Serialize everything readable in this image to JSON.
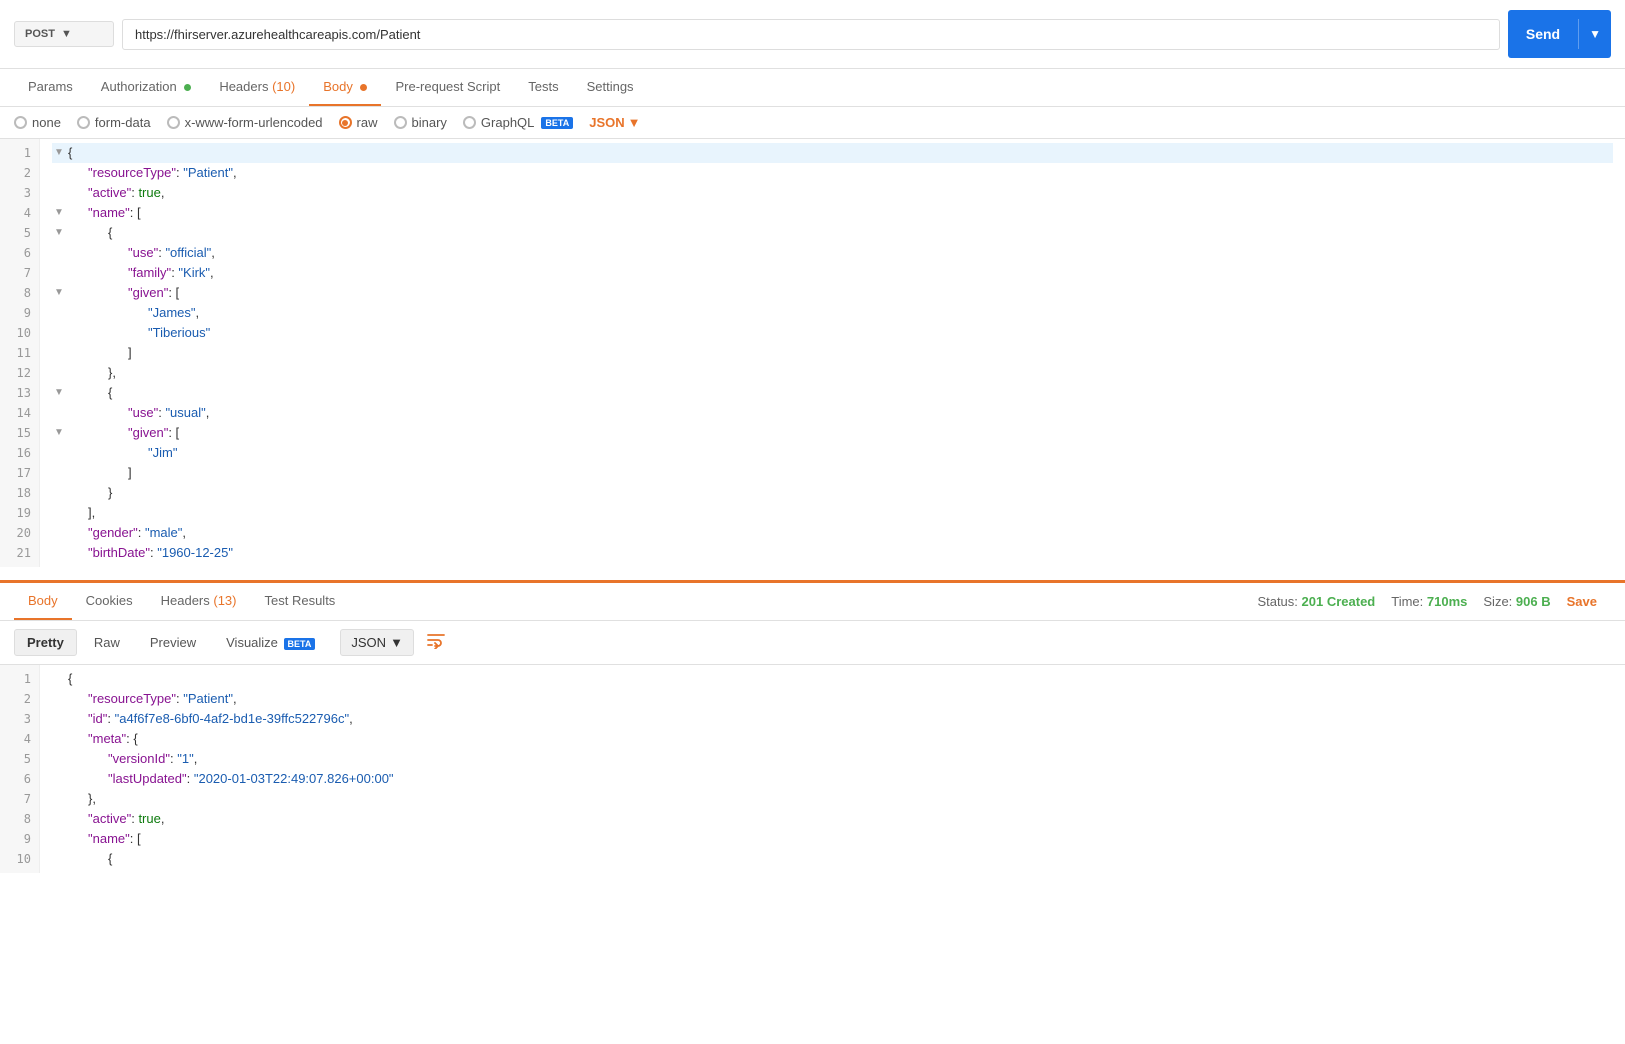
{
  "method": "POST",
  "url": "https://fhirserver.azurehealthcareapis.com/Patient",
  "send_label": "Send",
  "request_tabs": [
    {
      "id": "params",
      "label": "Params",
      "active": false,
      "dot": null
    },
    {
      "id": "authorization",
      "label": "Authorization",
      "active": false,
      "dot": "green"
    },
    {
      "id": "headers",
      "label": "Headers",
      "active": false,
      "dot": null,
      "count": "(10)"
    },
    {
      "id": "body",
      "label": "Body",
      "active": true,
      "dot": "orange"
    },
    {
      "id": "prerequest",
      "label": "Pre-request Script",
      "active": false,
      "dot": null
    },
    {
      "id": "tests",
      "label": "Tests",
      "active": false,
      "dot": null
    },
    {
      "id": "settings",
      "label": "Settings",
      "active": false,
      "dot": null
    }
  ],
  "body_options": [
    {
      "id": "none",
      "label": "none",
      "selected": false
    },
    {
      "id": "form-data",
      "label": "form-data",
      "selected": false
    },
    {
      "id": "x-www-form-urlencoded",
      "label": "x-www-form-urlencoded",
      "selected": false
    },
    {
      "id": "raw",
      "label": "raw",
      "selected": true
    },
    {
      "id": "binary",
      "label": "binary",
      "selected": false
    },
    {
      "id": "graphql",
      "label": "GraphQL",
      "selected": false,
      "beta": true
    }
  ],
  "json_format_label": "JSON",
  "request_code_lines": [
    {
      "num": 1,
      "indent": 0,
      "toggle": true,
      "content": "{"
    },
    {
      "num": 2,
      "indent": 1,
      "toggle": false,
      "content": "\"resourceType\": \"Patient\","
    },
    {
      "num": 3,
      "indent": 1,
      "toggle": false,
      "content": "\"active\": true,"
    },
    {
      "num": 4,
      "indent": 1,
      "toggle": true,
      "content": "\"name\": ["
    },
    {
      "num": 5,
      "indent": 2,
      "toggle": true,
      "content": "{"
    },
    {
      "num": 6,
      "indent": 3,
      "toggle": false,
      "content": "\"use\": \"official\","
    },
    {
      "num": 7,
      "indent": 3,
      "toggle": false,
      "content": "\"family\": \"Kirk\","
    },
    {
      "num": 8,
      "indent": 3,
      "toggle": true,
      "content": "\"given\": ["
    },
    {
      "num": 9,
      "indent": 4,
      "toggle": false,
      "content": "\"James\","
    },
    {
      "num": 10,
      "indent": 4,
      "toggle": false,
      "content": "\"Tiberious\""
    },
    {
      "num": 11,
      "indent": 3,
      "toggle": false,
      "content": "]"
    },
    {
      "num": 12,
      "indent": 2,
      "toggle": false,
      "content": "},"
    },
    {
      "num": 13,
      "indent": 2,
      "toggle": true,
      "content": "{"
    },
    {
      "num": 14,
      "indent": 3,
      "toggle": false,
      "content": "\"use\": \"usual\","
    },
    {
      "num": 15,
      "indent": 3,
      "toggle": true,
      "content": "\"given\": ["
    },
    {
      "num": 16,
      "indent": 4,
      "toggle": false,
      "content": "\"Jim\""
    },
    {
      "num": 17,
      "indent": 3,
      "toggle": false,
      "content": "]"
    },
    {
      "num": 18,
      "indent": 2,
      "toggle": false,
      "content": "}"
    },
    {
      "num": 19,
      "indent": 1,
      "toggle": false,
      "content": "],"
    },
    {
      "num": 20,
      "indent": 1,
      "toggle": false,
      "content": "\"gender\": \"male\","
    },
    {
      "num": 21,
      "indent": 1,
      "toggle": false,
      "content": "\"birthDate\": \"1960-12-25\""
    }
  ],
  "response_tabs": [
    {
      "id": "body",
      "label": "Body",
      "active": true
    },
    {
      "id": "cookies",
      "label": "Cookies",
      "active": false
    },
    {
      "id": "headers",
      "label": "Headers",
      "count": "(13)",
      "active": false
    },
    {
      "id": "test-results",
      "label": "Test Results",
      "active": false
    }
  ],
  "response_status": {
    "status_label": "Status:",
    "status_value": "201 Created",
    "time_label": "Time:",
    "time_value": "710ms",
    "size_label": "Size:",
    "size_value": "906 B",
    "save_label": "Save"
  },
  "format_tabs": [
    {
      "id": "pretty",
      "label": "Pretty",
      "active": true
    },
    {
      "id": "raw",
      "label": "Raw",
      "active": false
    },
    {
      "id": "preview",
      "label": "Preview",
      "active": false
    },
    {
      "id": "visualize",
      "label": "Visualize",
      "active": false,
      "beta": true
    }
  ],
  "resp_format_label": "JSON",
  "response_code_lines": [
    {
      "num": 1,
      "content": "{"
    },
    {
      "num": 2,
      "content": "\"resourceType\": \"Patient\","
    },
    {
      "num": 3,
      "content": "\"id\": \"a4f6f7e8-6bf0-4af2-bd1e-39ffc522796c\","
    },
    {
      "num": 4,
      "content": "\"meta\": {"
    },
    {
      "num": 5,
      "content": "\"versionId\": \"1\","
    },
    {
      "num": 6,
      "content": "\"lastUpdated\": \"2020-01-03T22:49:07.826+00:00\""
    },
    {
      "num": 7,
      "content": "},"
    },
    {
      "num": 8,
      "content": "\"active\": true,"
    },
    {
      "num": 9,
      "content": "\"name\": ["
    },
    {
      "num": 10,
      "content": "{"
    }
  ]
}
